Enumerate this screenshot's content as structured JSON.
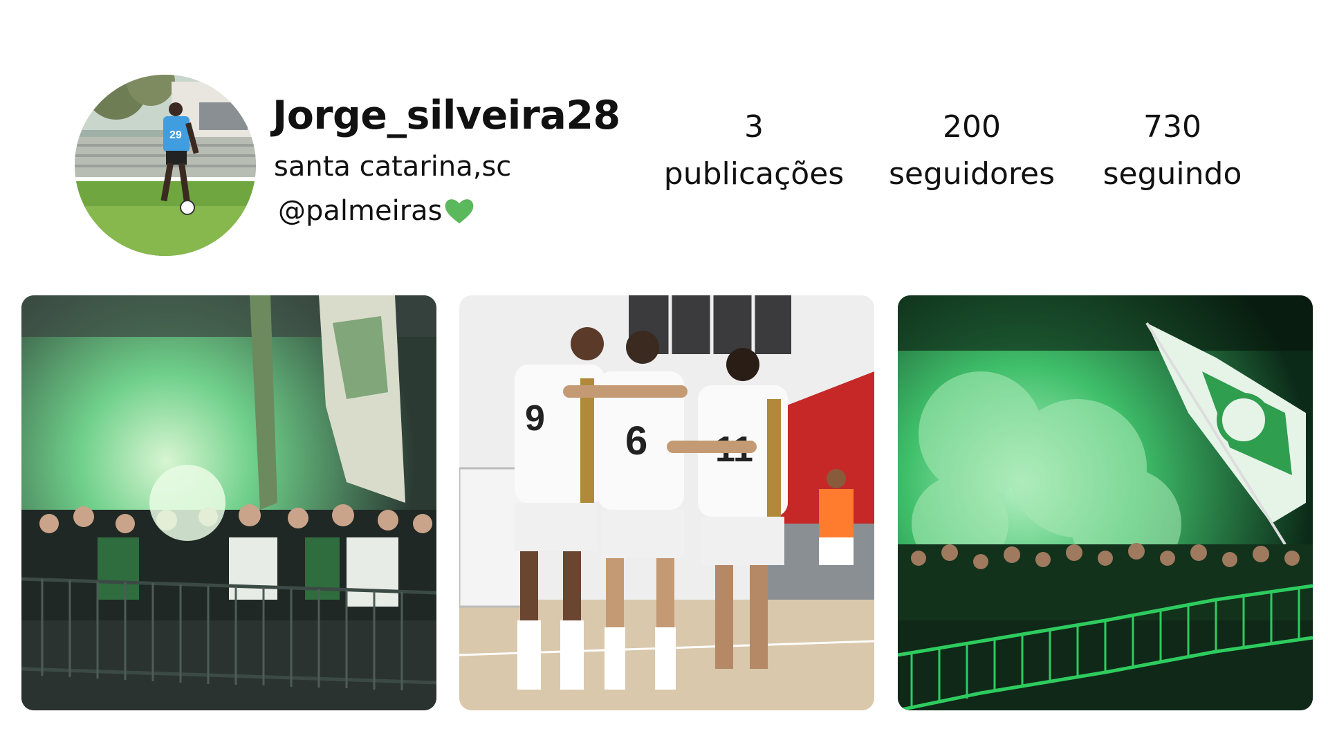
{
  "profile": {
    "username": "Jorge_silveira28",
    "location": "santa catarina,sc",
    "mention": "@palmeiras",
    "heart_icon": "green-heart-icon",
    "avatar_alt": "profile photo"
  },
  "stats": {
    "posts_count": "3",
    "posts_label": "publicações",
    "followers_count": "200",
    "followers_label": "seguidores",
    "following_count": "730",
    "following_label": "seguindo"
  },
  "colors": {
    "heart": "#5cb85c",
    "text": "#111111",
    "background": "#ffffff"
  },
  "posts": [
    {
      "image": "stadium-fans-green-flares-photo"
    },
    {
      "image": "futsal-team-celebration-photo"
    },
    {
      "image": "night-fans-green-smoke-flag-photo"
    }
  ]
}
